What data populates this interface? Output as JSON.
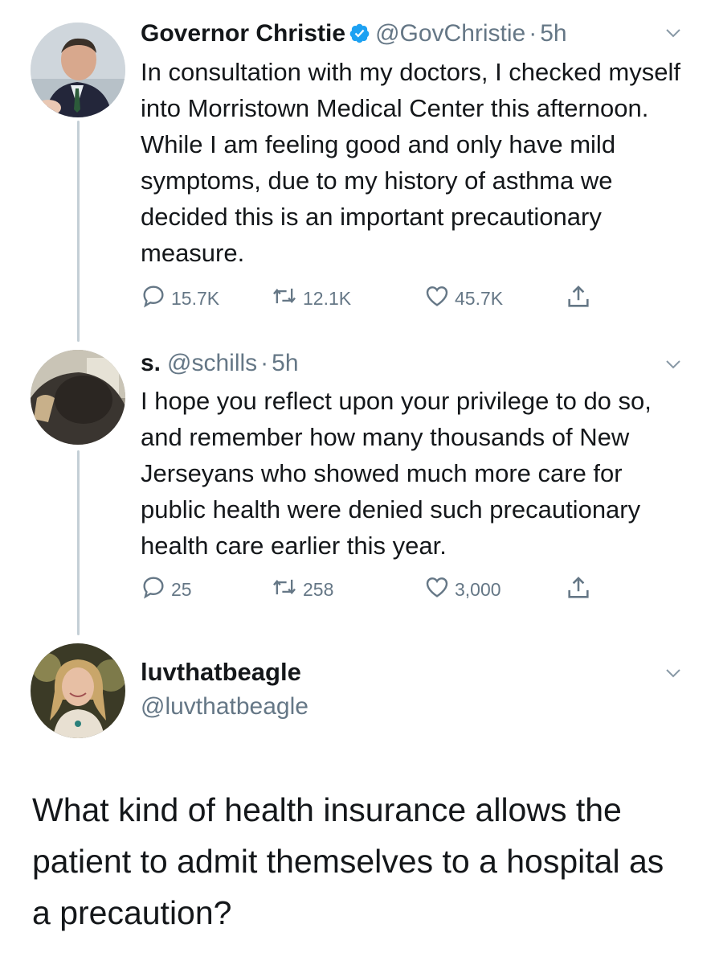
{
  "colors": {
    "text": "#14171a",
    "secondary": "#657786",
    "verified": "#1da1f2",
    "thread_line": "#c4cfd6"
  },
  "tweets": [
    {
      "name": "Governor Christie",
      "verified": true,
      "handle": "@GovChristie",
      "separator": "·",
      "time": "5h",
      "text": "In consultation with my doctors, I checked myself into Morristown Medical Center this afternoon. While I am feeling good and only have mild symptoms, due to my history of asthma we decided this is an important precautionary measure.",
      "replies": "15.7K",
      "retweets": "12.1K",
      "likes": "45.7K"
    },
    {
      "name": "s.",
      "verified": false,
      "handle": "@schills",
      "separator": "·",
      "time": "5h",
      "text": "I hope you reflect upon your privilege to do so, and remember how many thousands of New Jerseyans who showed much more care for public health were denied such precautionary health care earlier this year.",
      "replies": "25",
      "retweets": "258",
      "likes": "3,000"
    }
  ],
  "reply": {
    "name": "luvthatbeagle",
    "handle": "@luvthatbeagle",
    "text": "What kind of health insurance allows the patient to admit themselves to a hospital as a precaution?"
  },
  "icons": [
    "verified-badge-icon",
    "chevron-down-icon",
    "reply-icon",
    "retweet-icon",
    "like-icon",
    "share-icon"
  ]
}
